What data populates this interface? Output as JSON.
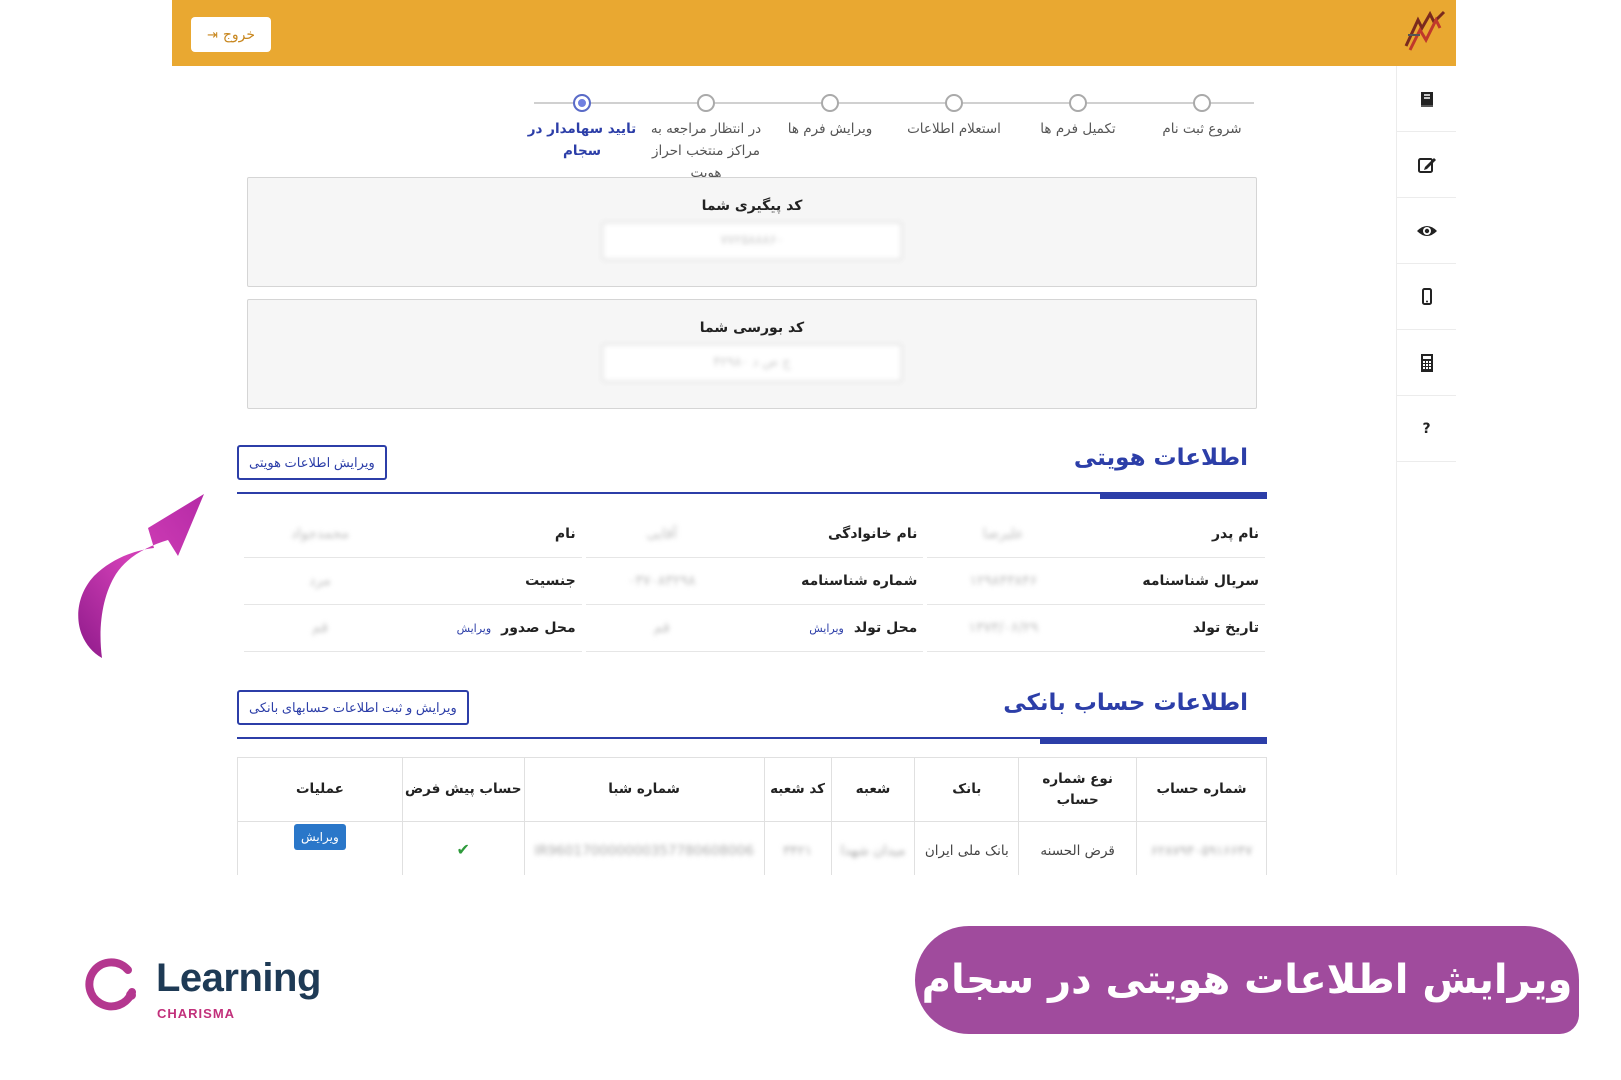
{
  "header": {
    "logout_label": "خروج"
  },
  "stepper": {
    "steps": [
      {
        "label": "شروع ثبت نام",
        "active": false
      },
      {
        "label": "تکمیل فرم ها",
        "active": false
      },
      {
        "label": "استعلام اطلاعات",
        "active": false
      },
      {
        "label": "ویرایش فرم ها",
        "active": false
      },
      {
        "label": "در انتظار مراجعه به مراکز منتخب احراز هویت",
        "active": false
      },
      {
        "label": "تایید سهامدار در سجام",
        "active": true
      }
    ]
  },
  "tracking": {
    "title": "کد پیگیری شما",
    "value": "۷۷۲۵۸۸۸۶۰"
  },
  "exchange": {
    "title": "کد بورسی شما",
    "value": "ج ص د ۴۲۹۸۰"
  },
  "identity": {
    "title": "اطلاعات هویتی",
    "edit_button": "ویرایش اطلاعات هویتی",
    "edit_link": "ویرایش",
    "rows": [
      [
        {
          "label": "نام",
          "value": "محمدجواد"
        },
        {
          "label": "نام خانوادگی",
          "value": "آقایی"
        },
        {
          "label": "نام پدر",
          "value": "علیرضا"
        }
      ],
      [
        {
          "label": "جنسیت",
          "value": "مرد"
        },
        {
          "label": "شماره شناسنامه",
          "value": "۰۳۷۰۸۳۲۹۸"
        },
        {
          "label": "سریال شناسنامه",
          "value": "۱۲۹۸۴۳۸۴۶"
        }
      ],
      [
        {
          "label": "محل صدور",
          "value": "قم"
        },
        {
          "label": "محل تولد",
          "value": "قم"
        },
        {
          "label": "تاریخ تولد",
          "value": "۱۳۷۳/۰۶/۲۹"
        }
      ]
    ]
  },
  "bank": {
    "title": "اطلاعات حساب بانکی",
    "edit_button": "ویرایش و ثبت اطلاعات حسابهای بانکی",
    "headers": [
      "شماره حساب",
      "نوع شماره حساب",
      "بانک",
      "شعبه",
      "کد شعبه",
      "شماره شبا",
      "حساب پیش فرض",
      "عملیات"
    ],
    "row": {
      "account": "۶۲۸۷۹۴۰۵۹۱۶۶۴۷",
      "type": "قرض الحسنه",
      "bank": "بانک ملی ایران",
      "branch": "میدان شهدا",
      "branch_code": "۳۴۲۱",
      "sheba": "IR960170000000357780608006",
      "default": "✔",
      "action": "ویرایش"
    }
  },
  "brand": {
    "name": "Learning",
    "sub": "CHARISMA"
  },
  "banner": {
    "text": "ویرایش اطلاعات هویتی در سجام"
  },
  "colors": {
    "header": "#e9a831",
    "primary": "#2c3ea8",
    "banner": "#a04b9d",
    "arrow": "#c2309e"
  }
}
